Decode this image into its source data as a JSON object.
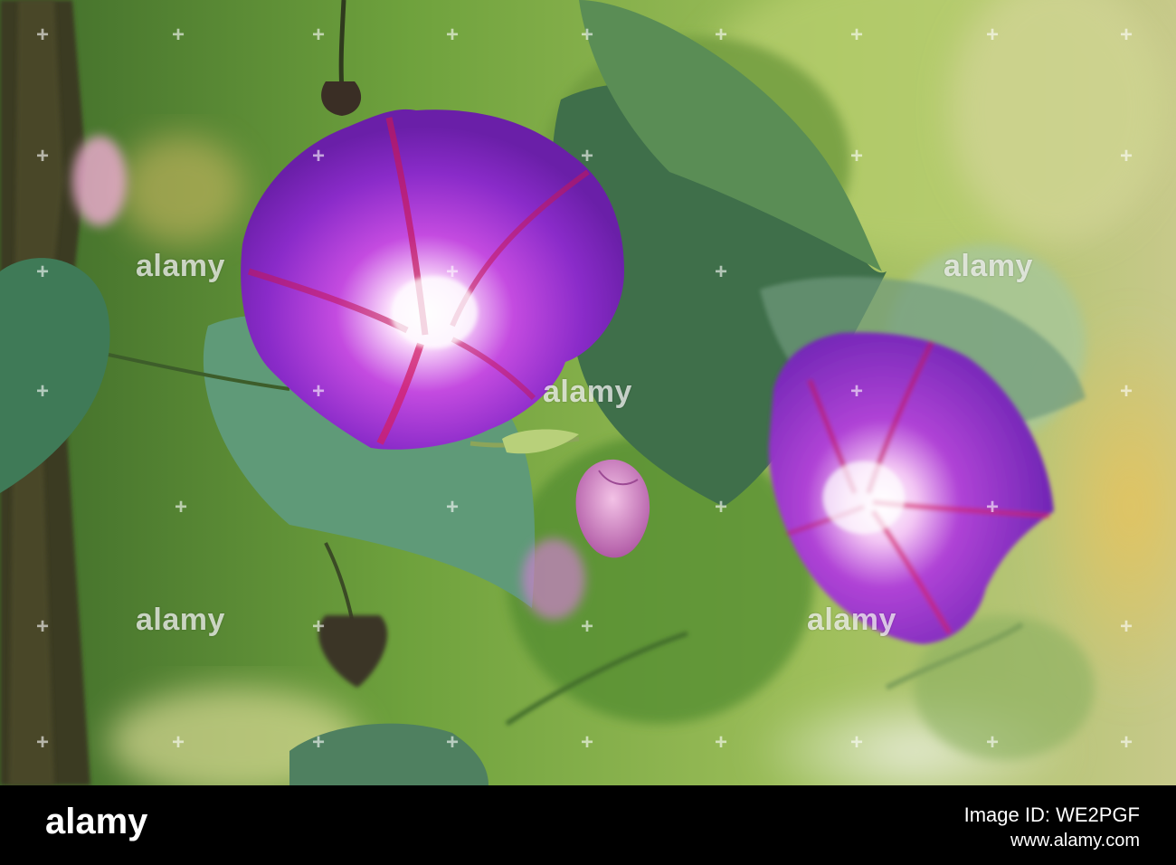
{
  "photo": {
    "subject": "Two purple morning glory flowers with a pink bud among green heart-shaped leaves"
  },
  "watermark": {
    "text": "alamy"
  },
  "footer": {
    "brand": "alamy",
    "image_id": "Image ID: WE2PGF",
    "url": "www.alamy.com"
  },
  "colors": {
    "petal": "#8a2bc9",
    "throat": "#f6d8f8",
    "leaf": "#5f9060",
    "bar": "#000000"
  }
}
